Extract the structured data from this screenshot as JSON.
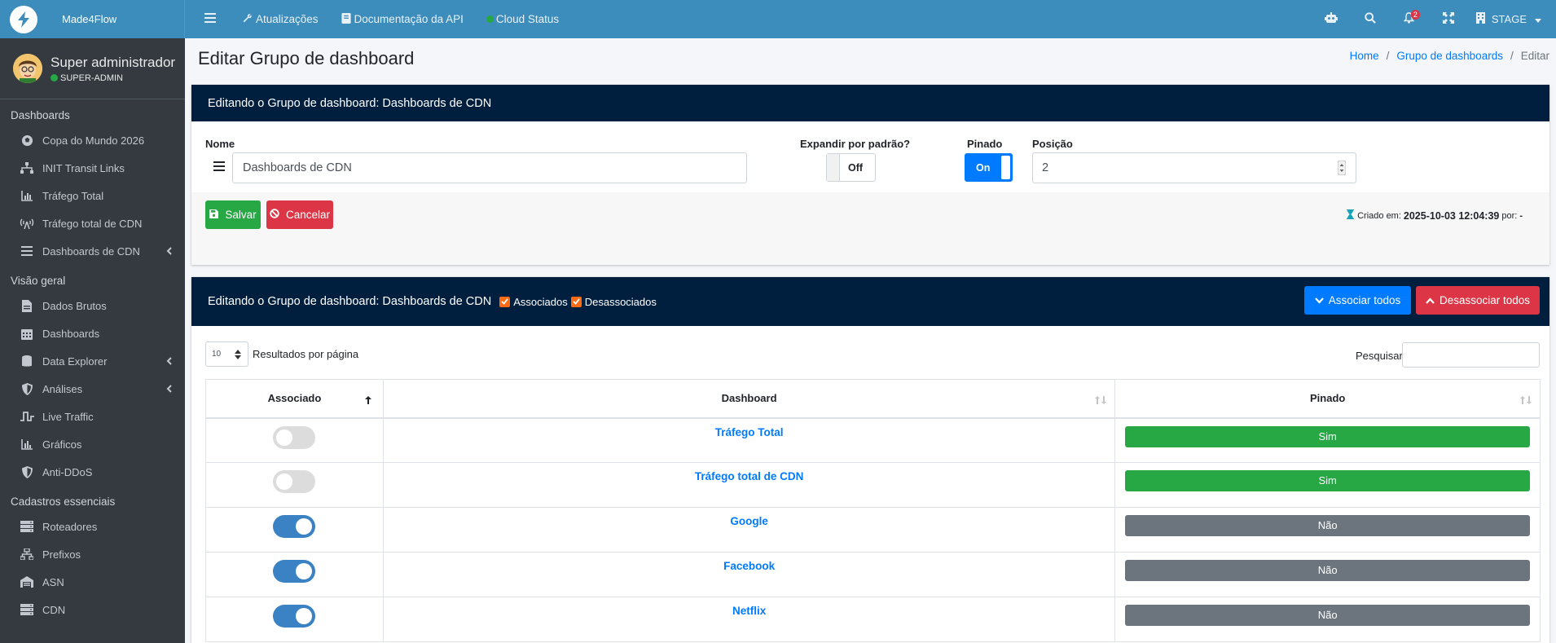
{
  "app": {
    "brand": "Made4Flow"
  },
  "topnav": {
    "links": [
      {
        "label": "Atualizações",
        "icon": "wrench-icon"
      },
      {
        "label": "Documentação da API",
        "icon": "book-icon"
      },
      {
        "label": "Cloud Status",
        "icon": "status-dot-icon"
      }
    ],
    "notification_count": "2",
    "environment": "STAGE"
  },
  "user": {
    "name": "Super administrador",
    "role": "SUPER-ADMIN"
  },
  "sidebar": {
    "sections": [
      {
        "header": "Dashboards",
        "items": [
          {
            "label": "Copa do Mundo 2026",
            "icon": "soccer-ball-icon"
          },
          {
            "label": "INIT Transit Links",
            "icon": "sitemap-icon"
          },
          {
            "label": "Tráfego Total",
            "icon": "bar-chart-icon"
          },
          {
            "label": "Tráfego total de CDN",
            "icon": "broadcast-tower-icon"
          },
          {
            "label": "Dashboards de CDN",
            "icon": "list-icon",
            "caret": true
          }
        ]
      },
      {
        "header": "Visão geral",
        "items": [
          {
            "label": "Dados Brutos",
            "icon": "file-icon"
          },
          {
            "label": "Dashboards",
            "icon": "calendar-grid-icon"
          },
          {
            "label": "Data Explorer",
            "icon": "database-icon",
            "caret": true
          },
          {
            "label": "Análises",
            "icon": "shield-icon",
            "caret": true
          },
          {
            "label": "Live Traffic",
            "icon": "pulse-icon"
          },
          {
            "label": "Gráficos",
            "icon": "chart-icon"
          },
          {
            "label": "Anti-DDoS",
            "icon": "shield-icon"
          }
        ]
      },
      {
        "header": "Cadastros essenciais",
        "items": [
          {
            "label": "Roteadores",
            "icon": "server-icon"
          },
          {
            "label": "Prefixos",
            "icon": "network-icon"
          },
          {
            "label": "ASN",
            "icon": "warehouse-icon"
          },
          {
            "label": "CDN",
            "icon": "server-icon"
          }
        ]
      }
    ]
  },
  "page": {
    "title": "Editar Grupo de dashboard",
    "breadcrumb": {
      "home": "Home",
      "parent": "Grupo de dashboards",
      "current": "Editar",
      "sep": "/"
    }
  },
  "form": {
    "header": "Editando o Grupo de dashboard: Dashboards de CDN",
    "nome_label": "Nome",
    "nome_value": "Dashboards de CDN",
    "expandir_label": "Expandir por padrão?",
    "expandir_value": "Off",
    "pinado_label": "Pinado",
    "pinado_value": "On",
    "posicao_label": "Posição",
    "posicao_value": "2",
    "save_label": "Salvar",
    "cancel_label": "Cancelar",
    "created_prefix": "Criado em:",
    "created_at": "2025-10-03 12:04:39",
    "created_by_prefix": "por:",
    "created_by": "-"
  },
  "assoc": {
    "header": "Editando o Grupo de dashboard: Dashboards de CDN",
    "filter_associados": "Associados",
    "filter_desassociados": "Desassociados",
    "associar_todos": "Associar todos",
    "desassociar_todos": "Desassociar todos",
    "page_size": "10",
    "page_size_label": "Resultados por página",
    "search_label": "Pesquisar",
    "search_value": "",
    "columns": [
      "Associado",
      "Dashboard",
      "Pinado"
    ],
    "rows": [
      {
        "associado": false,
        "dashboard": "Tráfego Total",
        "pinado": "Sim"
      },
      {
        "associado": false,
        "dashboard": "Tráfego total de CDN",
        "pinado": "Sim"
      },
      {
        "associado": true,
        "dashboard": "Google",
        "pinado": "Não"
      },
      {
        "associado": true,
        "dashboard": "Facebook",
        "pinado": "Não"
      },
      {
        "associado": true,
        "dashboard": "Netflix",
        "pinado": "Não"
      }
    ]
  }
}
